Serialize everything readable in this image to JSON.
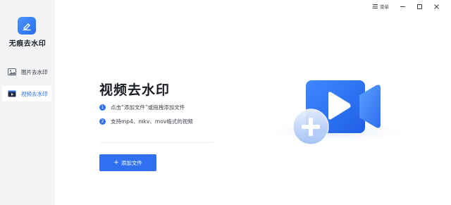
{
  "app": {
    "name": "无痕去水印"
  },
  "sidebar": {
    "items": [
      {
        "label": "图片去水印",
        "icon": "image-icon",
        "active": false
      },
      {
        "label": "视频去水印",
        "icon": "video-icon",
        "active": true
      }
    ]
  },
  "titlebar": {
    "menu_label": "菜单"
  },
  "main": {
    "title": "视频去水印",
    "steps": [
      {
        "num": "1",
        "text": "点击“添加文件”或拖拽添加文件"
      },
      {
        "num": "2",
        "text": "支持mp4、mkv、mov格式的视频"
      }
    ],
    "add_button": {
      "plus": "+",
      "label": "添加文件"
    }
  },
  "colors": {
    "accent": "#2f6ff0",
    "sidebar_bg": "#f3f4f6",
    "active_item_bg": "#ffffff"
  }
}
